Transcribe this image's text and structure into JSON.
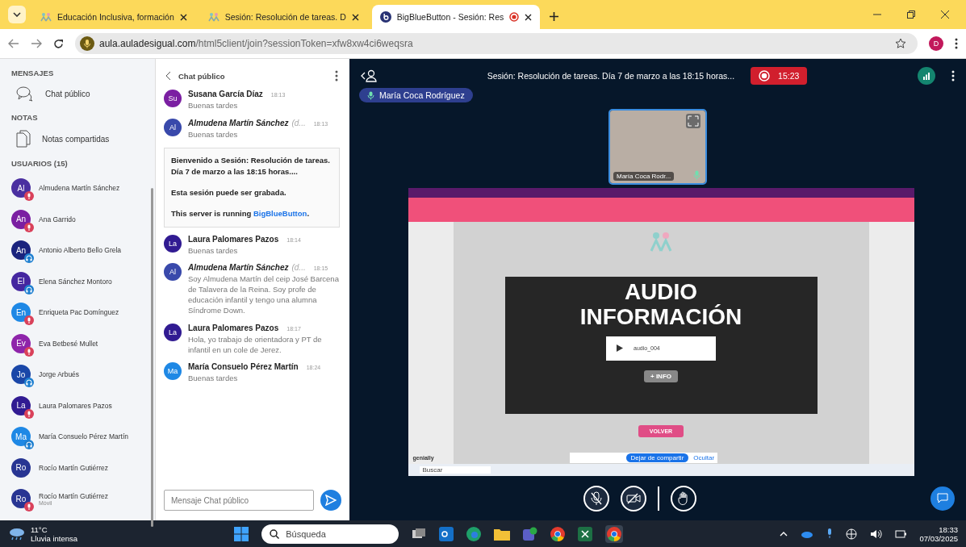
{
  "browser": {
    "tabs": [
      {
        "title": "Educación Inclusiva, formación",
        "kind": "site",
        "selected": false,
        "recording": false
      },
      {
        "title": "Sesión: Resolución de tareas. D",
        "kind": "site",
        "selected": false,
        "recording": false
      },
      {
        "title": "BigBlueButton - Sesión: Res",
        "kind": "bbb",
        "selected": true,
        "recording": true
      }
    ],
    "url_host": "aula.auladesigual.com",
    "url_path": "/html5client/join?sessionToken=xfw8xw4ci6weqsra",
    "profile_initial": "D"
  },
  "sidebar": {
    "messages_heading": "MENSAJES",
    "public_chat": "Chat público",
    "notes_heading": "NOTAS",
    "shared_notes": "Notas compartidas",
    "users_heading": "USUARIOS (15)",
    "users": [
      {
        "initials": "Al",
        "name": "Almudena Martín Sánchez",
        "color": "#4a2fa0",
        "kind": "mic"
      },
      {
        "initials": "An",
        "name": "Ana Garrido",
        "color": "#7b1fa2",
        "kind": "mic"
      },
      {
        "initials": "An",
        "name": "Antonio Alberto Bello Grela",
        "color": "#1a237e",
        "kind": "listen"
      },
      {
        "initials": "El",
        "name": "Elena Sánchez Montoro",
        "color": "#4527a0",
        "kind": "listen"
      },
      {
        "initials": "En",
        "name": "Enriqueta Pac Domínguez",
        "color": "#1e88e5",
        "kind": "mic"
      },
      {
        "initials": "Ev",
        "name": "Eva Betbesé Mullet",
        "color": "#8e24aa",
        "kind": "mic"
      },
      {
        "initials": "Jo",
        "name": "Jorge Arbués",
        "color": "#1a47a8",
        "kind": "listen"
      },
      {
        "initials": "La",
        "name": "Laura Palomares Pazos",
        "color": "#311b92",
        "kind": "mic"
      },
      {
        "initials": "Ma",
        "name": "María Consuelo Pérez Martín",
        "color": "#1e88e5",
        "kind": "listen"
      },
      {
        "initials": "Ro",
        "name": "Rocío Martín Gutiérrez",
        "color": "#283593",
        "kind": "none"
      },
      {
        "initials": "Ro",
        "name": "Rocío Martín Gutiérrez",
        "color": "#283593",
        "kind": "mic",
        "subtitle": "Móvil"
      }
    ]
  },
  "chat": {
    "title": "Chat público",
    "messages": [
      {
        "initials": "Su",
        "color": "#7b1fa2",
        "name": "Susana García Díaz",
        "moderator": false,
        "time": "18:13",
        "text": "Buenas tardes"
      },
      {
        "initials": "Al",
        "color": "#3949ab",
        "name": "Almudena Martín Sánchez",
        "moderator": true,
        "suffix": "(d...",
        "time": "18:13",
        "text": "Buenas tardes"
      },
      {
        "kind": "welcome",
        "intro": "Bienvenido a Sesión: Resolución de tareas. Día 7 de marzo a las 18:15 horas....",
        "note": "Esta sesión puede ser grabada.",
        "server_text": "This server is running",
        "link": "BigBlueButton",
        "server_end": "."
      },
      {
        "initials": "La",
        "color": "#311b92",
        "name": "Laura Palomares Pazos",
        "moderator": false,
        "time": "18:14",
        "text": "Buenas tardes"
      },
      {
        "initials": "Al",
        "color": "#3949ab",
        "name": "Almudena Martín Sánchez",
        "moderator": true,
        "suffix": "(d...",
        "time": "18:15",
        "text": "Soy Almudena Martín del ceip José Barcena de Talavera de la Reina. Soy profe de educación infantil y tengo una alumna Síndrome Down."
      },
      {
        "initials": "La",
        "color": "#311b92",
        "name": "Laura Palomares Pazos",
        "moderator": false,
        "time": "18:17",
        "text": "Hola, yo trabajo de orientadora y PT de infantil en un cole de Jerez."
      },
      {
        "initials": "Ma",
        "color": "#1e88e5",
        "name": "María Consuelo Pérez Martín",
        "moderator": false,
        "time": "18:24",
        "text": "Buenas tardes"
      }
    ],
    "input": {
      "placeholder": "Mensaje Chat público"
    }
  },
  "meeting": {
    "session_title": "Sesión: Resolución de tareas. Día 7 de marzo a las 18:15 horas...",
    "recording": true,
    "recording_time": "15:23",
    "talker": "María Coca Rodríguez",
    "webcam_name": "María Coca Rodr...",
    "screenshare": {
      "title_line_1": "AUDIO",
      "title_line_2": "INFORMACIÓN",
      "audio_label": "audio_004",
      "info_button": "+ INFO",
      "back_button": "VOLVER",
      "brand": "genially",
      "share_notice_button": "Dejar de compartir",
      "hide_link": "Ocultar",
      "search": "Buscar"
    },
    "controls": {
      "mic_muted": true,
      "camera_off": true
    }
  },
  "taskbar": {
    "temperature": "11°C",
    "weather": "Lluvia intensa",
    "search": "Búsqueda",
    "time": "18:33",
    "date": "07/03/2025"
  }
}
